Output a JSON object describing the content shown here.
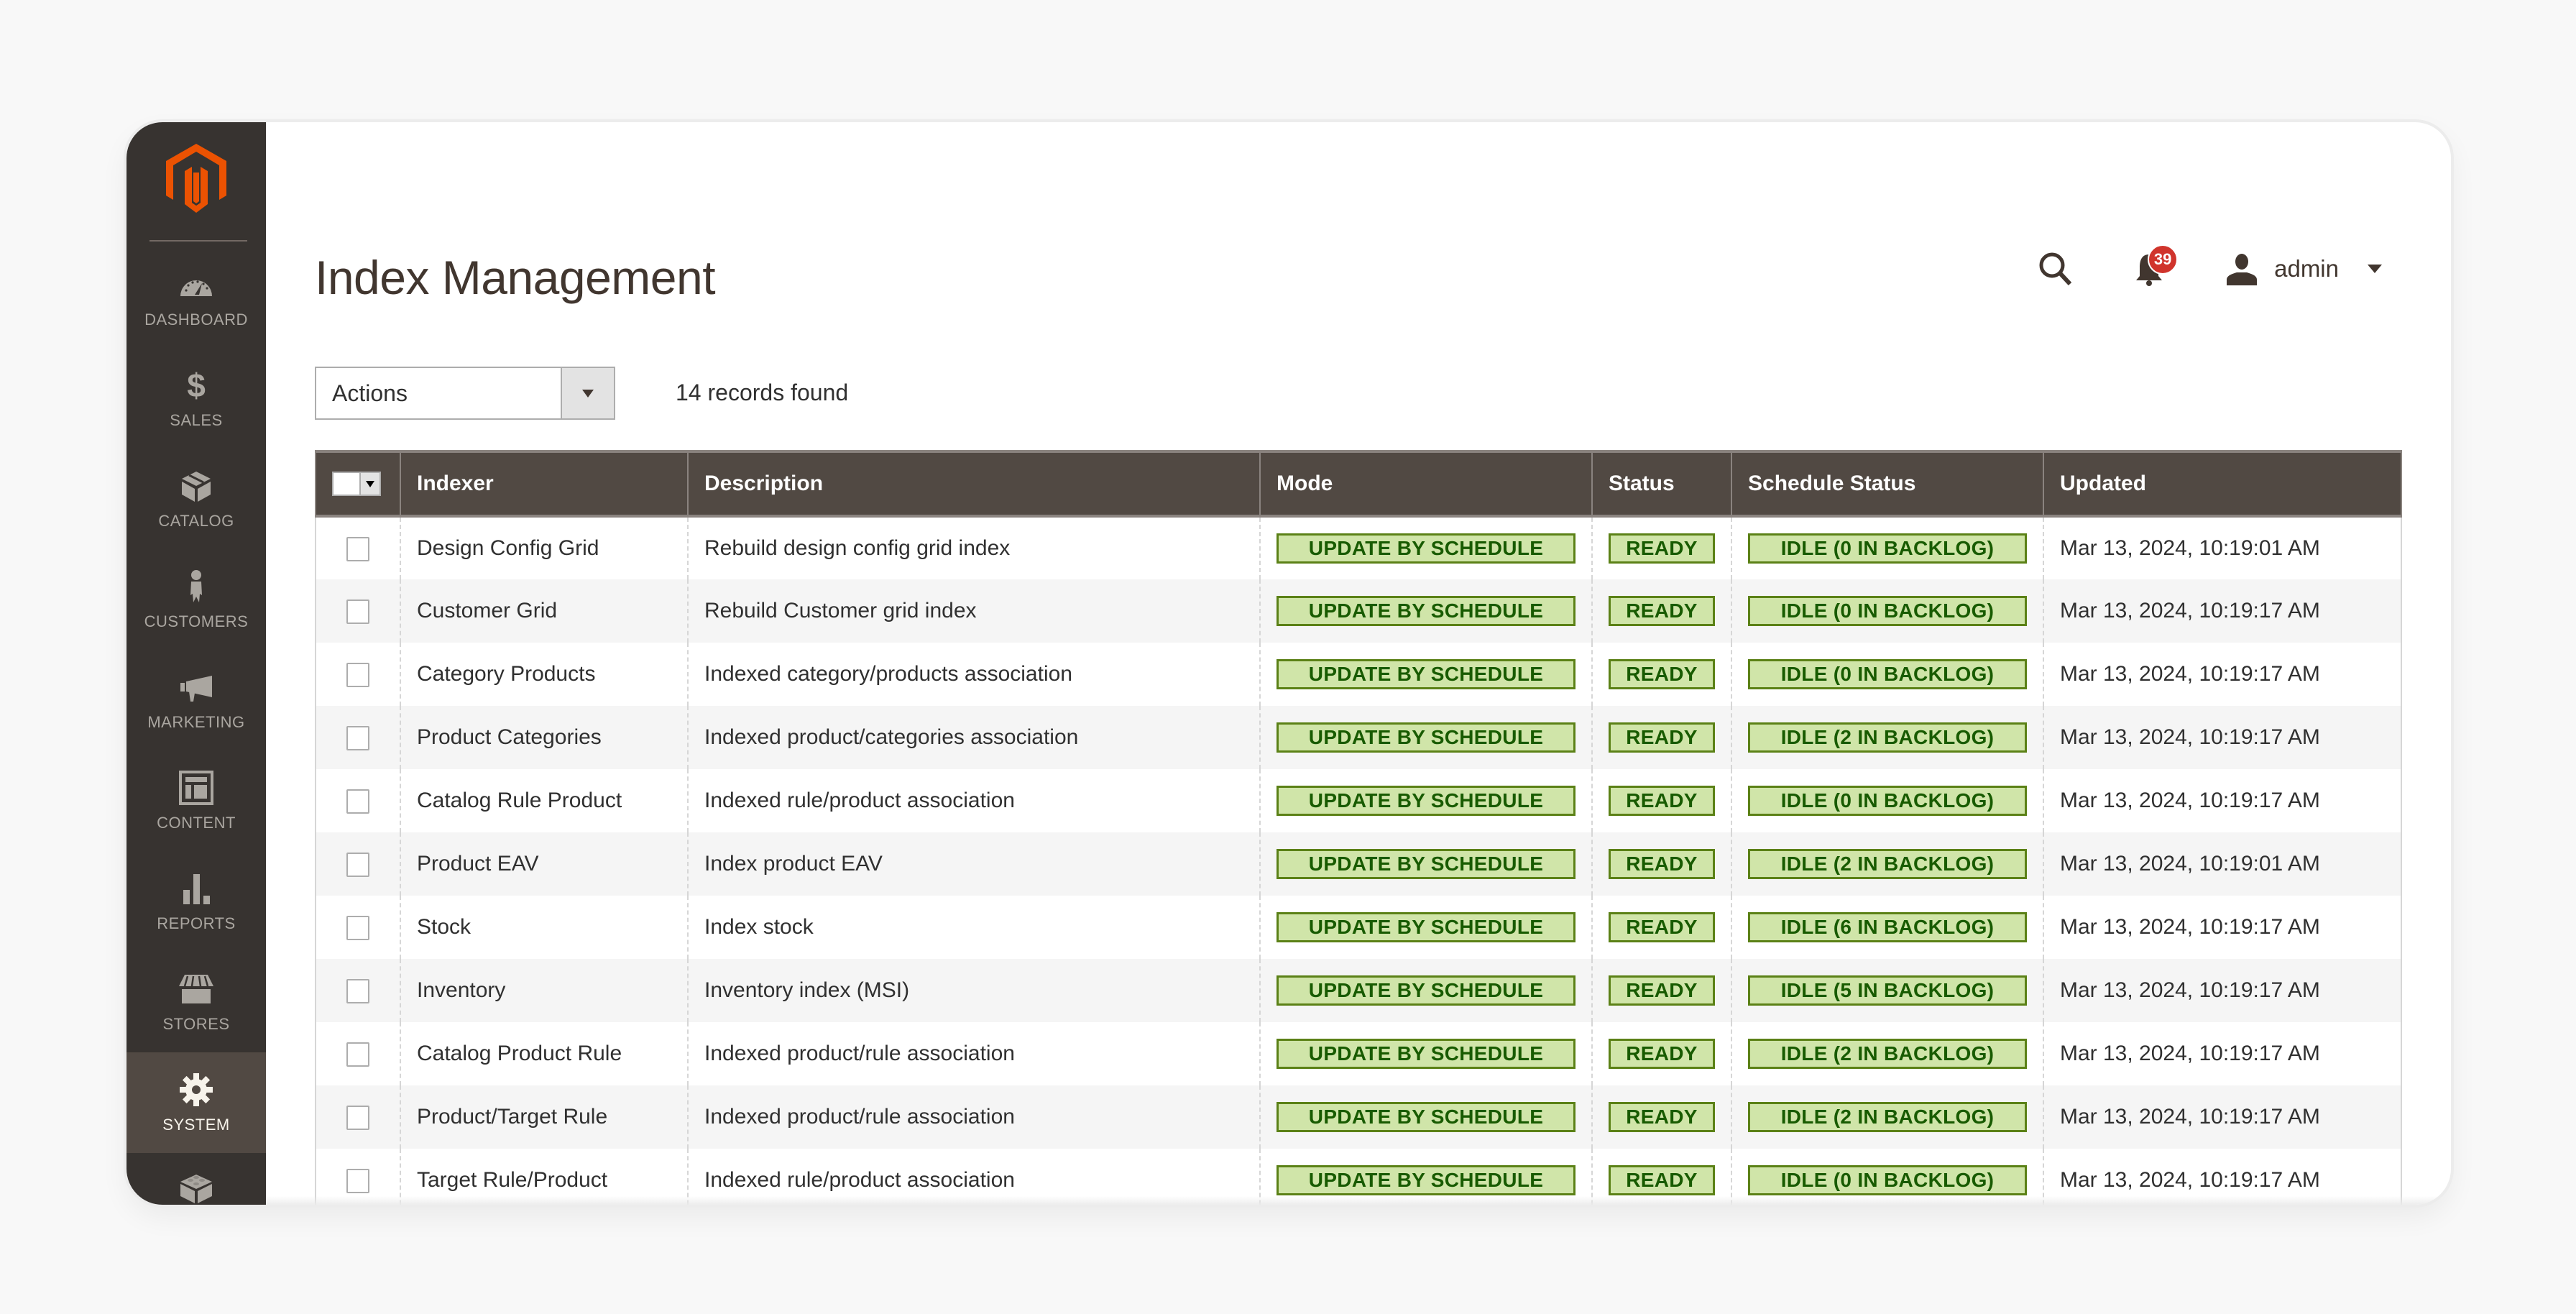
{
  "brand": {
    "accent": "#eb5202",
    "logo": "magento-logo-icon"
  },
  "sidebar": {
    "items": [
      {
        "label": "Dashboard",
        "icon": "dashboard-gauge-icon",
        "active": false
      },
      {
        "label": "Sales",
        "icon": "dollar-icon",
        "active": false
      },
      {
        "label": "Catalog",
        "icon": "box-icon",
        "active": false
      },
      {
        "label": "Customers",
        "icon": "person-icon",
        "active": false
      },
      {
        "label": "Marketing",
        "icon": "megaphone-icon",
        "active": false
      },
      {
        "label": "Content",
        "icon": "layout-icon",
        "active": false
      },
      {
        "label": "Reports",
        "icon": "bar-chart-icon",
        "active": false
      },
      {
        "label": "Stores",
        "icon": "storefront-icon",
        "active": false
      },
      {
        "label": "System",
        "icon": "gear-icon",
        "active": true
      },
      {
        "label": "",
        "icon": "extensions-brick-icon",
        "active": false
      }
    ]
  },
  "header": {
    "title": "Index Management",
    "notifications_count": "39",
    "user_name": "admin"
  },
  "toolbar": {
    "actions_label": "Actions",
    "records_found": "14 records found"
  },
  "grid": {
    "columns": [
      "Indexer",
      "Description",
      "Mode",
      "Status",
      "Schedule Status",
      "Updated"
    ],
    "rows": [
      {
        "indexer": "Design Config Grid",
        "description": "Rebuild design config grid index",
        "mode": "UPDATE BY SCHEDULE",
        "status": "READY",
        "schedule_status": "IDLE (0 IN BACKLOG)",
        "updated": "Mar 13, 2024, 10:19:01 AM"
      },
      {
        "indexer": "Customer Grid",
        "description": "Rebuild Customer grid index",
        "mode": "UPDATE BY SCHEDULE",
        "status": "READY",
        "schedule_status": "IDLE (0 IN BACKLOG)",
        "updated": "Mar 13, 2024, 10:19:17 AM"
      },
      {
        "indexer": "Category Products",
        "description": "Indexed category/products association",
        "mode": "UPDATE BY SCHEDULE",
        "status": "READY",
        "schedule_status": "IDLE (0 IN BACKLOG)",
        "updated": "Mar 13, 2024, 10:19:17 AM"
      },
      {
        "indexer": "Product Categories",
        "description": "Indexed product/categories association",
        "mode": "UPDATE BY SCHEDULE",
        "status": "READY",
        "schedule_status": "IDLE (2 IN BACKLOG)",
        "updated": "Mar 13, 2024, 10:19:17 AM"
      },
      {
        "indexer": "Catalog Rule Product",
        "description": "Indexed rule/product association",
        "mode": "UPDATE BY SCHEDULE",
        "status": "READY",
        "schedule_status": "IDLE (0 IN BACKLOG)",
        "updated": "Mar 13, 2024, 10:19:17 AM"
      },
      {
        "indexer": "Product EAV",
        "description": "Index product EAV",
        "mode": "UPDATE BY SCHEDULE",
        "status": "READY",
        "schedule_status": "IDLE (2 IN BACKLOG)",
        "updated": "Mar 13, 2024, 10:19:01 AM"
      },
      {
        "indexer": "Stock",
        "description": "Index stock",
        "mode": "UPDATE BY SCHEDULE",
        "status": "READY",
        "schedule_status": "IDLE (6 IN BACKLOG)",
        "updated": "Mar 13, 2024, 10:19:17 AM"
      },
      {
        "indexer": "Inventory",
        "description": "Inventory index (MSI)",
        "mode": "UPDATE BY SCHEDULE",
        "status": "READY",
        "schedule_status": "IDLE (5 IN BACKLOG)",
        "updated": "Mar 13, 2024, 10:19:17 AM"
      },
      {
        "indexer": "Catalog Product Rule",
        "description": "Indexed product/rule association",
        "mode": "UPDATE BY SCHEDULE",
        "status": "READY",
        "schedule_status": "IDLE (2 IN BACKLOG)",
        "updated": "Mar 13, 2024, 10:19:17 AM"
      },
      {
        "indexer": "Product/Target Rule",
        "description": "Indexed product/rule association",
        "mode": "UPDATE BY SCHEDULE",
        "status": "READY",
        "schedule_status": "IDLE (2 IN BACKLOG)",
        "updated": "Mar 13, 2024, 10:19:17 AM"
      },
      {
        "indexer": "Target Rule/Product",
        "description": "Indexed rule/product association",
        "mode": "UPDATE BY SCHEDULE",
        "status": "READY",
        "schedule_status": "IDLE (0 IN BACKLOG)",
        "updated": "Mar 13, 2024, 10:19:17 AM"
      }
    ]
  },
  "colors": {
    "sidebar_bg": "#373330",
    "sidebar_active_bg": "#514943",
    "grid_header_bg": "#514943",
    "badge_bg": "#d0e5a9",
    "badge_border": "#5b8116",
    "badge_text": "#185b00",
    "notification_badge": "#d0342c"
  }
}
